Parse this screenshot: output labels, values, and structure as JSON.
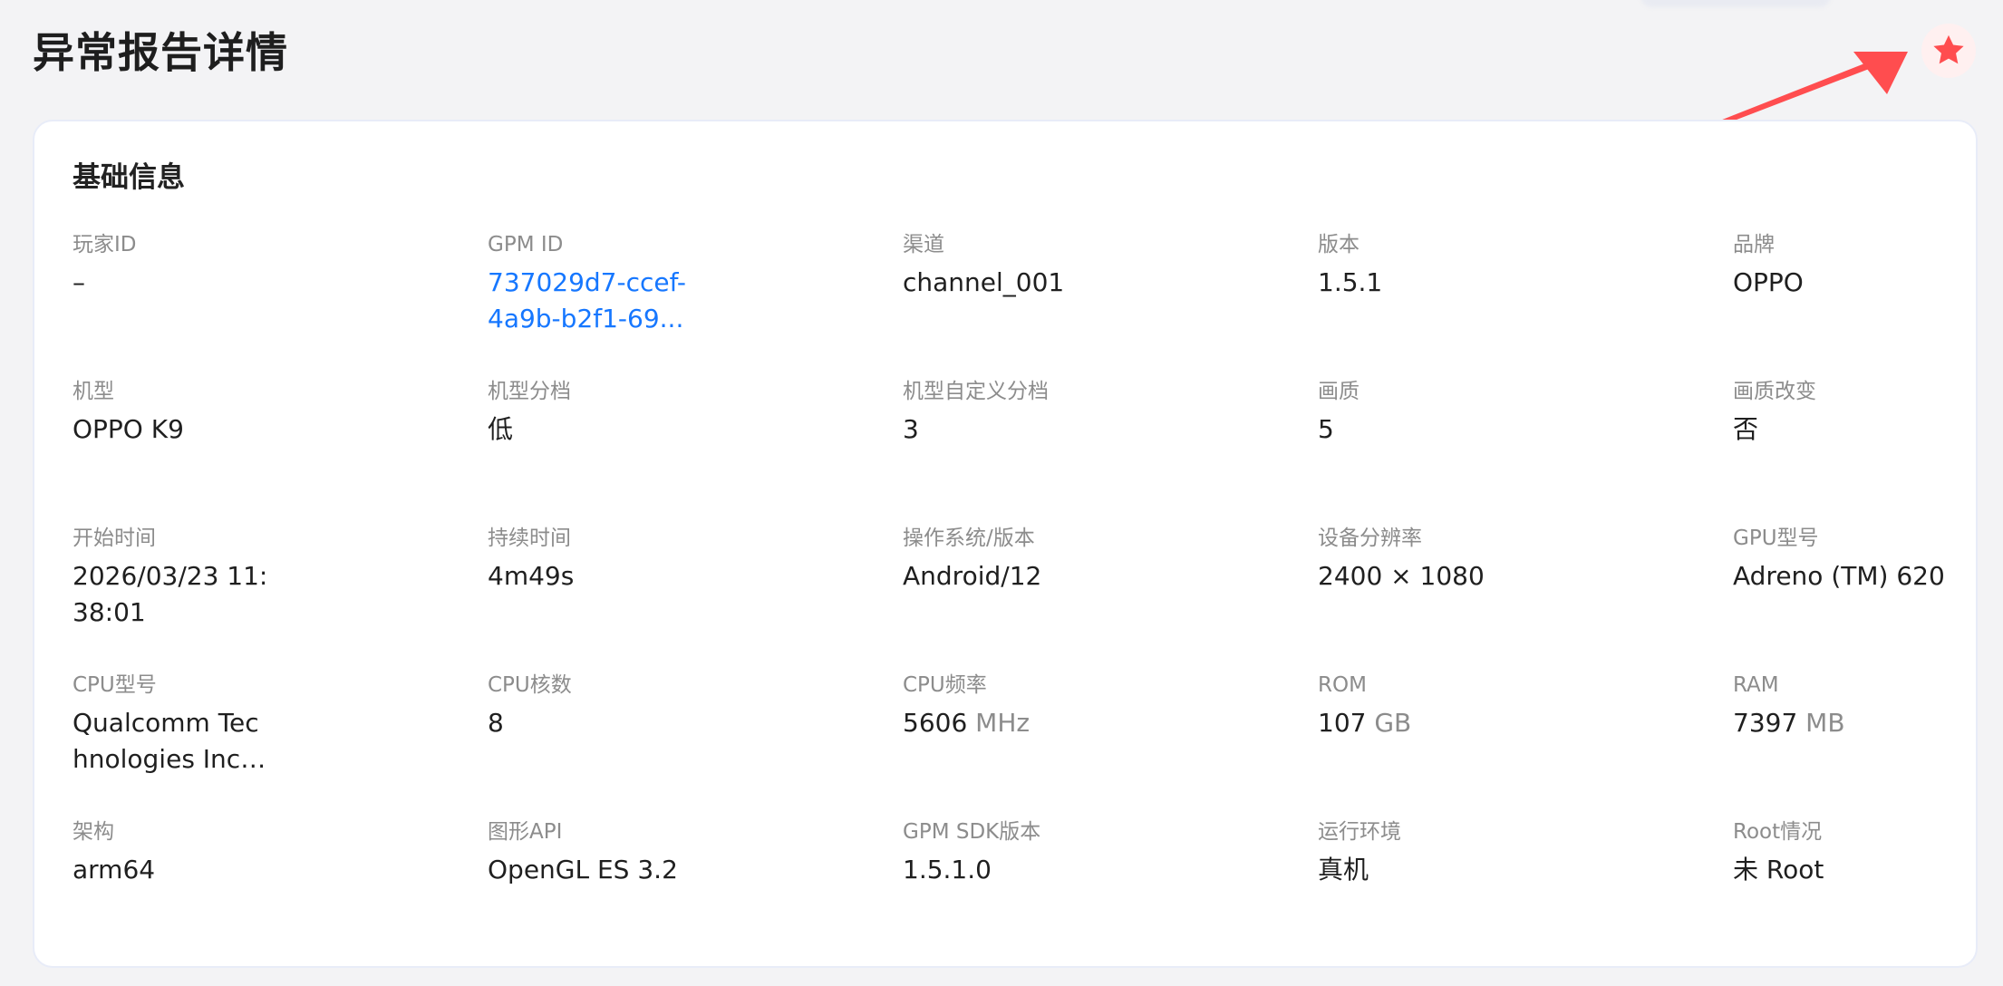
{
  "page": {
    "title": "异常报告详情",
    "favorite_icon": "star-icon",
    "favorite_color": "#ff4d4f",
    "arrow_color": "#ff4d4f"
  },
  "basic_info": {
    "title": "基础信息",
    "link_color": "#1677ff",
    "fields": [
      {
        "label": "玩家ID",
        "value": "–"
      },
      {
        "label": "GPM ID",
        "value": "737029d7-ccef-4a9b-b2f1-69..."
      },
      {
        "label": "渠道",
        "value": "channel_001"
      },
      {
        "label": "版本",
        "value": "1.5.1"
      },
      {
        "label": "品牌",
        "value": "OPPO"
      },
      {
        "label": "机型",
        "value": "OPPO K9"
      },
      {
        "label": "机型分档",
        "value": "低"
      },
      {
        "label": "机型自定义分档",
        "value": "3"
      },
      {
        "label": "画质",
        "value": "5"
      },
      {
        "label": "画质改变",
        "value": "否"
      },
      {
        "label": "开始时间",
        "value": "2026/03/23 11:38:01"
      },
      {
        "label": "持续时间",
        "value": "4m49s"
      },
      {
        "label": "操作系统/版本",
        "value": "Android/12"
      },
      {
        "label": "设备分辨率",
        "value": "2400 × 1080"
      },
      {
        "label": "GPU型号",
        "value": "Adreno (TM) 620"
      },
      {
        "label": "CPU型号",
        "value": "Qualcomm Technologies Inc S..."
      },
      {
        "label": "CPU核数",
        "value": "8"
      },
      {
        "label": "CPU频率",
        "value": "5606",
        "unit": "MHz"
      },
      {
        "label": "ROM",
        "value": "107",
        "unit": "GB"
      },
      {
        "label": "RAM",
        "value": "7397",
        "unit": "MB"
      },
      {
        "label": "架构",
        "value": "arm64"
      },
      {
        "label": "图形API",
        "value": "OpenGL ES 3.2"
      },
      {
        "label": "GPM SDK版本",
        "value": "1.5.1.0"
      },
      {
        "label": "运行环境",
        "value": "真机"
      },
      {
        "label": "Root情况",
        "value": "未 Root"
      }
    ]
  }
}
